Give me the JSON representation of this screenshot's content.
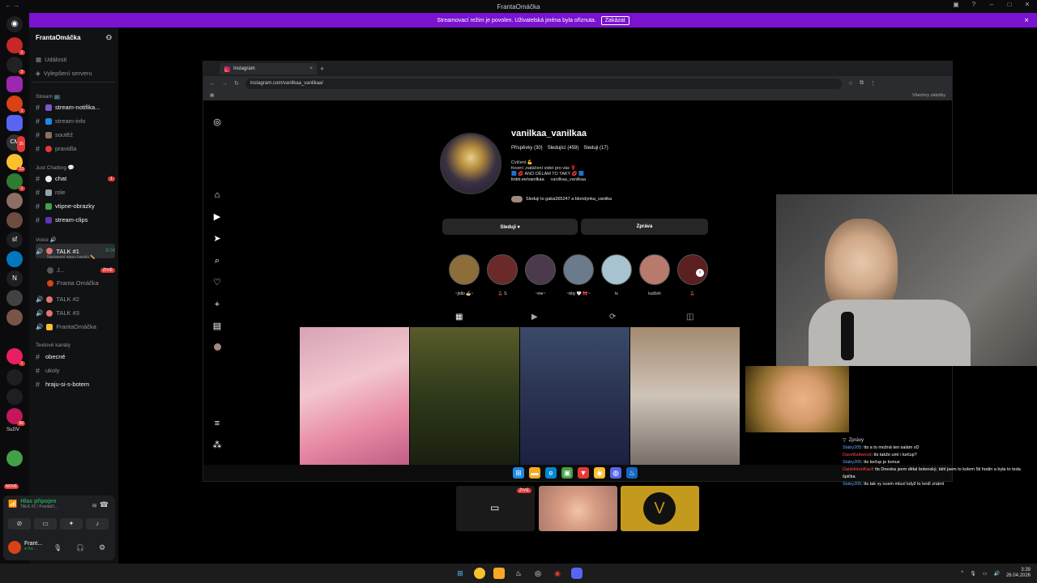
{
  "window": {
    "title": "FrantaOmáčka"
  },
  "banner": {
    "text": "Streamovací režim je povolen. Uživatelská jména byla ořiznuta.",
    "button": "Zakázat",
    "close": "×"
  },
  "server": {
    "name": "FrantaOmáčka"
  },
  "channels": {
    "events": "Události",
    "boost": "Vylepšení serveru",
    "cat_stream": "Stream 📺",
    "cat_chat": "Just Chatting 💬",
    "cat_voice": "Voice 🔊",
    "cat_text": "Textové kanály",
    "items": [
      {
        "name": "stream-notifika..."
      },
      {
        "name": "stream-info"
      },
      {
        "name": "soutěž"
      },
      {
        "name": "pravidla"
      },
      {
        "name": "chat",
        "badge": "1"
      },
      {
        "name": "role"
      },
      {
        "name": "vtipne-obrazky"
      },
      {
        "name": "stream-clips"
      }
    ],
    "voice": {
      "name": "TALK #1",
      "timer": "8:04",
      "status": "Nastavení stavu kanálu ✏️",
      "user1": "J...",
      "live": "ŽIVĚ",
      "user2": "Franta Omáčka"
    },
    "voice_other": [
      "TALK #2",
      "TALK #3",
      "FrantaOmáčka"
    ],
    "text": [
      "obecné",
      "ukoly",
      "hraju-si-s-botem"
    ]
  },
  "server_badges": [
    "2",
    "3",
    "1",
    "35",
    "23",
    "1",
    "1",
    "96"
  ],
  "server_labels": {
    "sf": "sf",
    "n": "N",
    "suziv": "SužIV",
    "nove": "NOVÉ"
  },
  "userpanel": {
    "voice_status": "Hlas připojen",
    "voice_channel": "TALK #1 / FrantaO...",
    "name": "Frant...",
    "sub": "● Kic..."
  },
  "browser": {
    "tab": "Instagram",
    "url": "instagram.com/vanilkaa_vanilkaa/",
    "bookmarks": "Všechny záložky"
  },
  "ig": {
    "username": "vanilkaa_vanilkaa",
    "posts": "Příspěvky (30)",
    "followers": "Sledující (459)",
    "following": "Sleduji (17)",
    "bio": [
      "Cvičení 💪",
      "focení ,natáčení videí pro vás 🌹",
      "🟦 💋 ANO DĚLÁM TO TAKY 💋 🟦"
    ],
    "link": "linktr.ee/vanilkaa",
    "threads": "vanilkaa_vanilkaa",
    "mutual": "Sleduji to gaba365247 a blondynka_vanilka",
    "follow_btn": "Sleduji ▾",
    "message_btn": "Zpráva",
    "highlights": [
      "~jídlo 🍝~",
      "🍒 S",
      "~me~",
      "~bby 🤍 🎀~",
      "ts",
      "kuličeh",
      "🍒"
    ]
  },
  "chat_overlay": {
    "header": "Zprávy",
    "lines": [
      {
        "user": "Staby205",
        "text": ": tts a to možná ten salám xD"
      },
      {
        "user": "DaveBaitwood",
        "text": ": tts takže umí i kečup?"
      },
      {
        "user": "Staby205",
        "text": ": tts kečup je bonus"
      },
      {
        "user": "DaniHidunKauf",
        "text": ": tts Dneska jsem dělal bolenský, táhl jsem to kolem 5ti hodin a byla to teda špička"
      },
      {
        "user": "Staby205",
        "text": ": tts tak vy ocem mluví když to tvrdí známí"
      }
    ]
  },
  "cards": {
    "live": "ŽIVĚ"
  },
  "taskbar": {
    "time": "3:39",
    "date": "26.04.2026"
  }
}
